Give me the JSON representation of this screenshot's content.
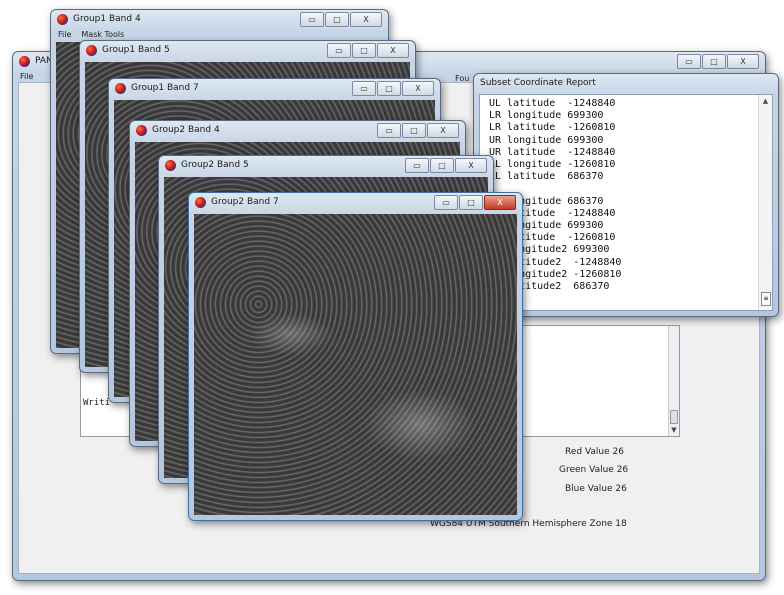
{
  "main_window": {
    "title": "PAN",
    "menu": [
      "File"
    ],
    "partial_menu": "Fou",
    "log_lines": [
      "Writi",
      "Writi"
    ],
    "red_value": "Red Value  26",
    "green_value": "Green Value  26",
    "blue_value": "Blue Value  26",
    "projection": "WGS84 UTM Southern Hemisphere Zone 18"
  },
  "windows": [
    {
      "title": "Group1 Band 4",
      "menu": [
        "File",
        "Mask Tools"
      ]
    },
    {
      "title": "Group1 Band 5"
    },
    {
      "title": "Group1 Band 7"
    },
    {
      "title": "Group2 Band 4"
    },
    {
      "title": "Group2 Band 5"
    },
    {
      "title": "Group2 Band 7"
    }
  ],
  "report": {
    "title": "Subset Coordinate Report",
    "lines": [
      "UL latitude  -1248840",
      "LR longitude 699300",
      "LR latitude  -1260810",
      "UR longitude 699300",
      "UR latitude  -1248840",
      "LL longitude -1260810",
      "LL latitude  686370",
      "",
      "UL longitude 686370",
      "UL latitude  -1248840",
      "LR longitude 699300",
      "LR latitude  -1260810",
      "UR longitude2 699300",
      "UR latitude2  -1248840",
      "LL longitude2 -1260810",
      "LL latitude2  686370"
    ]
  },
  "controls": {
    "minimize": "▭",
    "maximize": "□",
    "close": "X"
  }
}
